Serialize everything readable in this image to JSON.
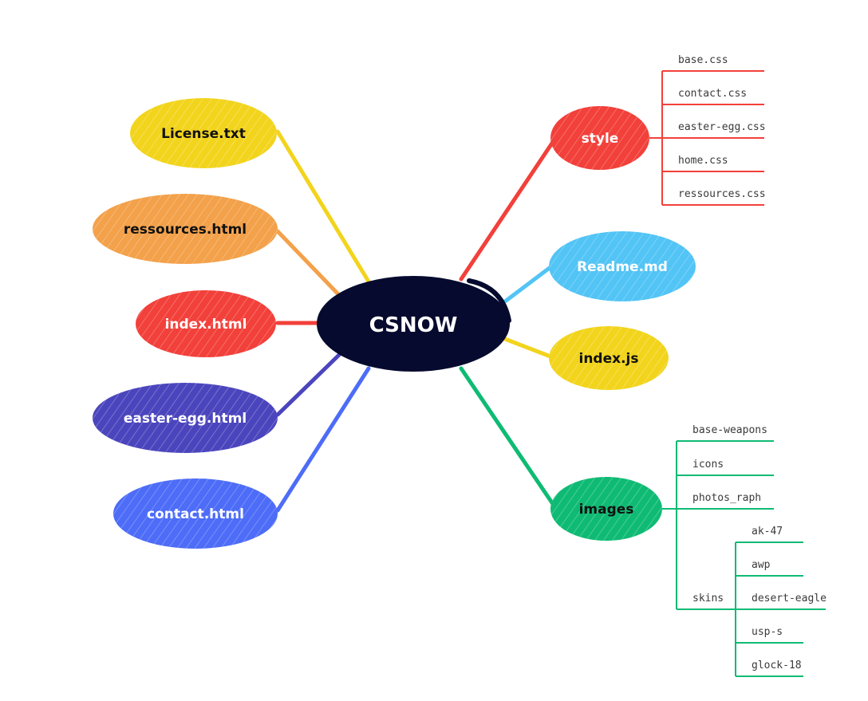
{
  "root": {
    "label": "CSNOW",
    "color": "#050a2e",
    "text_color": "#ffffff"
  },
  "left_nodes": [
    {
      "id": "license",
      "label": "License.txt",
      "color": "#f2d41d",
      "text_color": "#111111"
    },
    {
      "id": "ressources",
      "label": "ressources.html",
      "color": "#f3a14a",
      "text_color": "#111111"
    },
    {
      "id": "index_html",
      "label": "index.html",
      "color": "#f2403a",
      "text_color": "#ffffff"
    },
    {
      "id": "easter",
      "label": "easter-egg.html",
      "color": "#4b45bd",
      "text_color": "#ffffff"
    },
    {
      "id": "contact",
      "label": "contact.html",
      "color": "#4d6cf7",
      "text_color": "#ffffff"
    }
  ],
  "right_nodes": [
    {
      "id": "style",
      "label": "style",
      "color": "#f2403a",
      "text_color": "#ffffff",
      "children": [
        "base.css",
        "contact.css",
        "easter-egg.css",
        "home.css",
        "ressources.css"
      ]
    },
    {
      "id": "readme",
      "label": "Readme.md",
      "color": "#52c4f5",
      "text_color": "#ffffff",
      "children": []
    },
    {
      "id": "index_js",
      "label": "index.js",
      "color": "#f2d41d",
      "text_color": "#111111",
      "children": []
    },
    {
      "id": "images",
      "label": "images",
      "color": "#0fbb74",
      "text_color": "#111111",
      "children": [
        "base-weapons",
        "icons",
        "photos_raph",
        "skins"
      ],
      "sub": {
        "parent": "skins",
        "children": [
          "ak-47",
          "awp",
          "desert-eagle",
          "usp-s",
          "glock-18"
        ]
      }
    }
  ]
}
